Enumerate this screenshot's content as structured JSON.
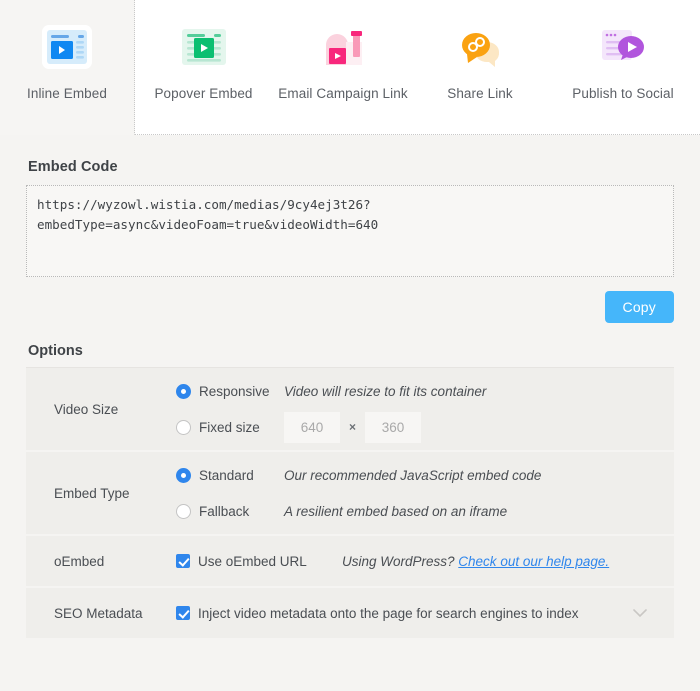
{
  "tabs": [
    {
      "label": "Inline Embed",
      "icon": "inline-embed-icon",
      "active": true
    },
    {
      "label": "Popover Embed",
      "icon": "popover-embed-icon",
      "active": false
    },
    {
      "label": "Email Campaign Link",
      "icon": "email-campaign-icon",
      "active": false
    },
    {
      "label": "Share Link",
      "icon": "share-link-icon",
      "active": false
    },
    {
      "label": "Publish to Social",
      "icon": "publish-social-icon",
      "active": false
    }
  ],
  "embed": {
    "label": "Embed Code",
    "code": "https://wyzowl.wistia.com/medias/9cy4ej3t26?embedType=async&videoFoam=true&videoWidth=640",
    "copy_label": "Copy"
  },
  "options": {
    "title": "Options",
    "video_size": {
      "name": "Video Size",
      "responsive_label": "Responsive",
      "responsive_hint": "Video will resize to fit its container",
      "fixed_label": "Fixed size",
      "width_value": "640",
      "height_value": "360",
      "times": "×"
    },
    "embed_type": {
      "name": "Embed Type",
      "standard_label": "Standard",
      "standard_hint": "Our recommended JavaScript embed code",
      "fallback_label": "Fallback",
      "fallback_hint": "A resilient embed based on an iframe"
    },
    "oembed": {
      "name": "oEmbed",
      "checkbox_label": "Use oEmbed URL",
      "hint_prefix": "Using WordPress? ",
      "hint_link": "Check out our help page."
    },
    "seo": {
      "name": "SEO Metadata",
      "checkbox_label": "Inject video metadata onto the page for search engines to index",
      "chevron": "⌄"
    }
  },
  "colors": {
    "accent_blue": "#2f86ec",
    "copy_blue": "#45b6fa",
    "panel_gray": "#efeeeb",
    "page_gray": "#f5f4f2"
  }
}
